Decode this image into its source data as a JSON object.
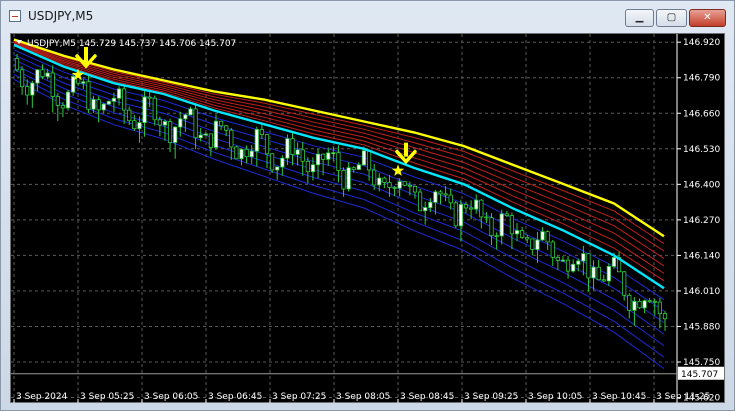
{
  "window": {
    "title": "USDJPY,M5",
    "buttons": {
      "minimize": "▁",
      "maximize": "▢",
      "close": "✕"
    }
  },
  "chart_header": {
    "symbol_line": "USDJPY,M5  145.729 145.737 145.706 145.707"
  },
  "colors": {
    "background": "#000000",
    "grid": "#5a5a5a",
    "bull_body": "#ffffff",
    "bear_body": "#000000",
    "wick": "#2ecc40",
    "ema_fast": "#00e6ff",
    "ema_slow": "#ffff00",
    "ribbon_red": "#c0201a",
    "ribbon_blue": "#1a2bd8",
    "marker": "#ffff00"
  },
  "chart_data": {
    "type": "candlestick",
    "title": "",
    "symbol": "USDJPY",
    "timeframe": "M5",
    "last_ohlc": {
      "open": 145.729,
      "high": 145.737,
      "low": 145.706,
      "close": 145.707
    },
    "current_price": 145.707,
    "ylim": [
      145.6,
      146.95
    ],
    "grid": true,
    "y_ticks": [
      146.92,
      146.79,
      146.66,
      146.53,
      146.4,
      146.27,
      146.14,
      146.01,
      145.88,
      145.75,
      145.62
    ],
    "y_tick_labels": [
      "146.920",
      "146.790",
      "146.660",
      "146.530",
      "146.400",
      "146.270",
      "146.140",
      "146.010",
      "145.880",
      "145.750",
      "145.620"
    ],
    "x_tick_labels": [
      "3 Sep 2024",
      "3 Sep 05:25",
      "3 Sep 06:05",
      "3 Sep 06:45",
      "3 Sep 07:25",
      "3 Sep 08:05",
      "3 Sep 08:45",
      "3 Sep 09:25",
      "3 Sep 10:05",
      "3 Sep 10:45",
      "3 Sep 11:25"
    ],
    "series": [
      {
        "name": "",
        "color": "#ffff00",
        "values": [
          146.93,
          146.87,
          146.82,
          146.78,
          146.74,
          146.71,
          146.67,
          146.63,
          146.59,
          146.54,
          146.47,
          146.4,
          146.33,
          146.21
        ]
      },
      {
        "name": "",
        "color": "#00e6ff",
        "values": [
          146.91,
          146.83,
          146.77,
          146.73,
          146.67,
          146.62,
          146.57,
          146.53,
          146.46,
          146.4,
          146.31,
          146.23,
          146.14,
          146.02
        ]
      }
    ],
    "signals": [
      {
        "type": "sell",
        "x_label": "3 Sep 05:25",
        "price": 146.8
      },
      {
        "type": "sell",
        "x_label": "3 Sep 08:45",
        "price": 146.45
      }
    ]
  }
}
